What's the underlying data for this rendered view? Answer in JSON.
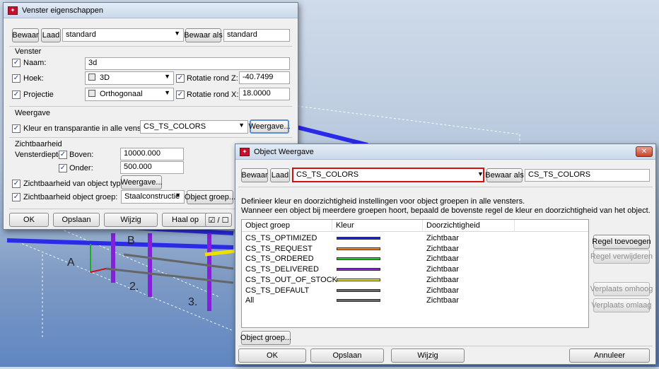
{
  "viewport": {
    "grid_labels": [
      "A",
      "B",
      "2.",
      "3."
    ]
  },
  "venster_dialog": {
    "title": "Venster eigenschappen",
    "toolbar": {
      "bewaar": "Bewaar",
      "laad": "Laad",
      "preset": "standard",
      "bewaar_als": "Bewaar als",
      "bewaar_als_value": "standard"
    },
    "venster_section": "Venster",
    "naam_label": "Naam:",
    "naam_value": "3d",
    "hoek_label": "Hoek:",
    "hoek_value": "3D",
    "rotatie_z_label": "Rotatie rond Z:",
    "rotatie_z_value": "-40.7499",
    "projectie_label": "Projectie",
    "projectie_value": "Orthogonaal",
    "rotatie_x_label": "Rotatie rond X:",
    "rotatie_x_value": "18.0000",
    "weergave_section": "Weergave",
    "kleur_label": "Kleur en transparantie in alle vensters:",
    "kleur_value": "CS_TS_COLORS",
    "weergave_btn": "Weergave...",
    "zicht_section": "Zichtbaarheid",
    "vensterdiepte_label": "Vensterdiepte:",
    "boven_label": "Boven:",
    "boven_value": "10000.000",
    "onder_label": "Onder:",
    "onder_value": "500.000",
    "zicht_types_label": "Zichtbaarheid van object types:",
    "zicht_types_btn": "Weergave...",
    "zicht_groep_label": "Zichtbaarheid object groep:",
    "zicht_groep_value": "Staalconstructie",
    "object_groep_btn": "Object groep...",
    "footer": {
      "ok": "OK",
      "opslaan": "Opslaan",
      "wijzig": "Wijzig",
      "haal_op": "Haal op",
      "toggle": "☑ / ☐"
    }
  },
  "object_dialog": {
    "title": "Object Weergave",
    "toolbar": {
      "bewaar": "Bewaar",
      "laad": "Laad",
      "preset": "CS_TS_COLORS",
      "bewaar_als": "Bewaar als",
      "bewaar_als_value": "CS_TS_COLORS"
    },
    "info_line1": "Definieer kleur en doorzichtigheid instellingen voor object groepen in alle vensters.",
    "info_line2": "Wanneer een object bij meerdere groepen hoort, bepaald de bovenste regel de kleur en doorzichtigheid van het object.",
    "columns": [
      "Object groep",
      "Kleur",
      "Doorzichtigheid"
    ],
    "rows": [
      {
        "group": "CS_TS_OPTIMIZED",
        "color": "#1e1ee0",
        "visibility": "Zichtbaar"
      },
      {
        "group": "CS_TS_REQUEST",
        "color": "#ff8a00",
        "visibility": "Zichtbaar"
      },
      {
        "group": "CS_TS_ORDERED",
        "color": "#19d419",
        "visibility": "Zichtbaar"
      },
      {
        "group": "CS_TS_DELIVERED",
        "color": "#8a1ed8",
        "visibility": "Zichtbaar"
      },
      {
        "group": "CS_TS_OUT_OF_STOCK",
        "color": "#f0e800",
        "visibility": "Zichtbaar"
      },
      {
        "group": "CS_TS_DEFAULT",
        "color": "#6a6a6a",
        "visibility": "Zichtbaar"
      },
      {
        "group": "All",
        "color": "#6a6a6a",
        "visibility": "Zichtbaar"
      }
    ],
    "side_buttons": {
      "regel_toevoegen": "Regel toevoegen",
      "regel_verwijderen": "Regel verwijderen",
      "verplaats_omhoog": "Verplaats omhoog",
      "verplaats_omlaag": "Verplaats omlaag"
    },
    "object_groep_btn": "Object groep...",
    "footer": {
      "ok": "OK",
      "opslaan": "Opslaan",
      "wijzig": "Wijzig",
      "annuleer": "Annuleer"
    }
  }
}
